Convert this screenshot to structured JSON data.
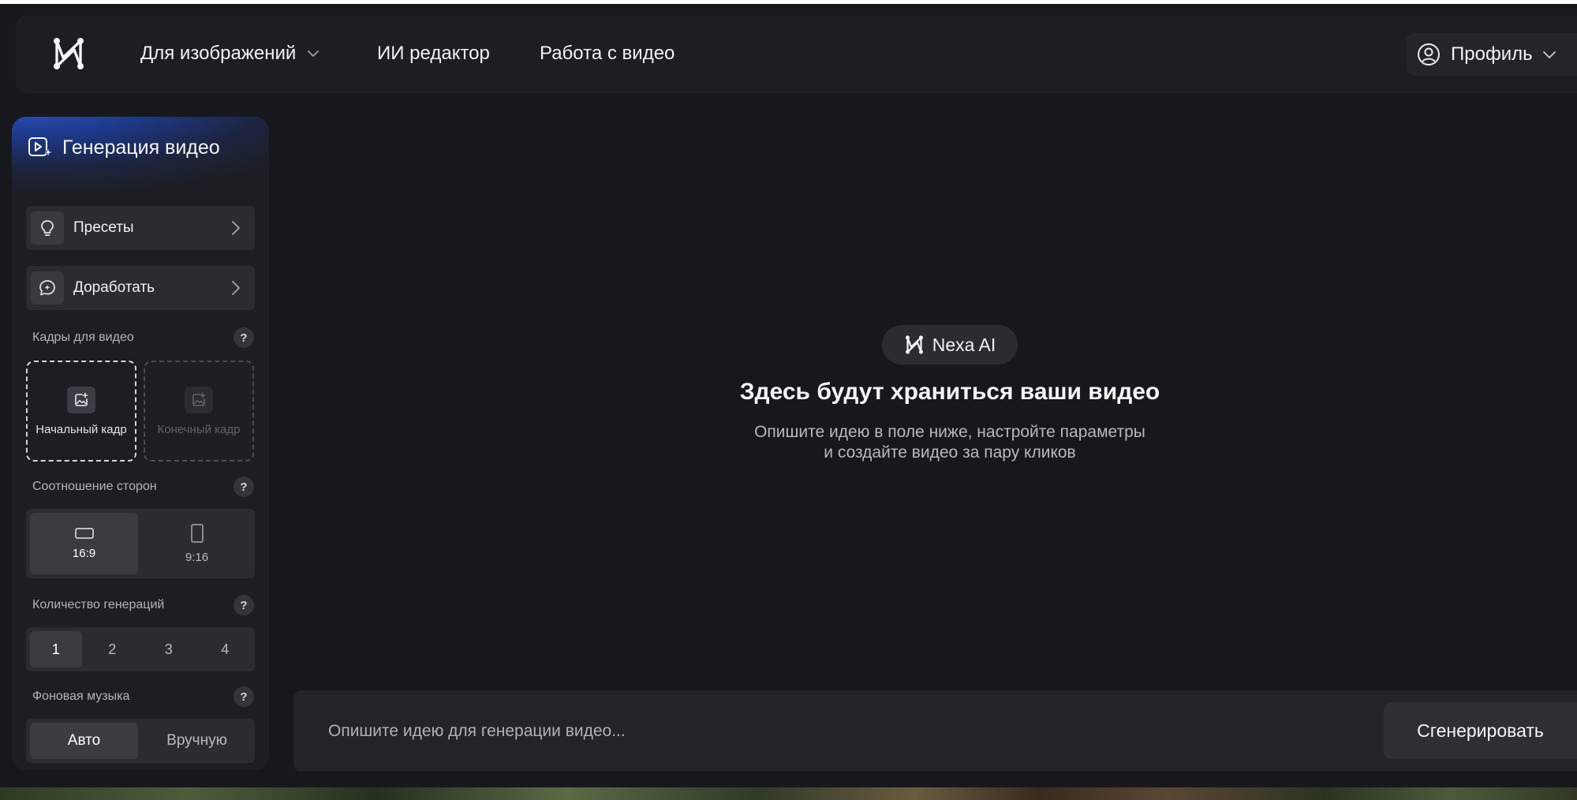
{
  "header": {
    "nav": [
      {
        "label": "Для изображений"
      },
      {
        "label": "ИИ редактор"
      },
      {
        "label": "Работа с видео"
      }
    ],
    "profile_label": "Профиль"
  },
  "sidebar": {
    "title": "Генерация видео",
    "presets_label": "Пресеты",
    "refine_label": "Доработать",
    "frames": {
      "label": "Кадры для видео",
      "help": "?",
      "start": "Начальный кадр",
      "end": "Конечный кадр"
    },
    "aspect": {
      "label": "Соотношение сторон",
      "help": "?",
      "options": [
        "16:9",
        "9:16"
      ],
      "selected": "16:9"
    },
    "count": {
      "label": "Количество генераций",
      "help": "?",
      "options": [
        "1",
        "2",
        "3",
        "4"
      ],
      "selected": "1"
    },
    "music": {
      "label": "Фоновая музыка",
      "help": "?",
      "options": [
        "Авто",
        "Вручную"
      ],
      "selected": "Авто"
    }
  },
  "main": {
    "badge": "Nexa AI",
    "empty_title": "Здесь будут храниться ваши видео",
    "empty_line1": "Опишите идею в поле ниже, настройте параметры",
    "empty_line2": "и создайте видео за пару кликов"
  },
  "prompt": {
    "placeholder": "Опишите идею для генерации видео...",
    "generate_label": "Сгенерировать"
  }
}
